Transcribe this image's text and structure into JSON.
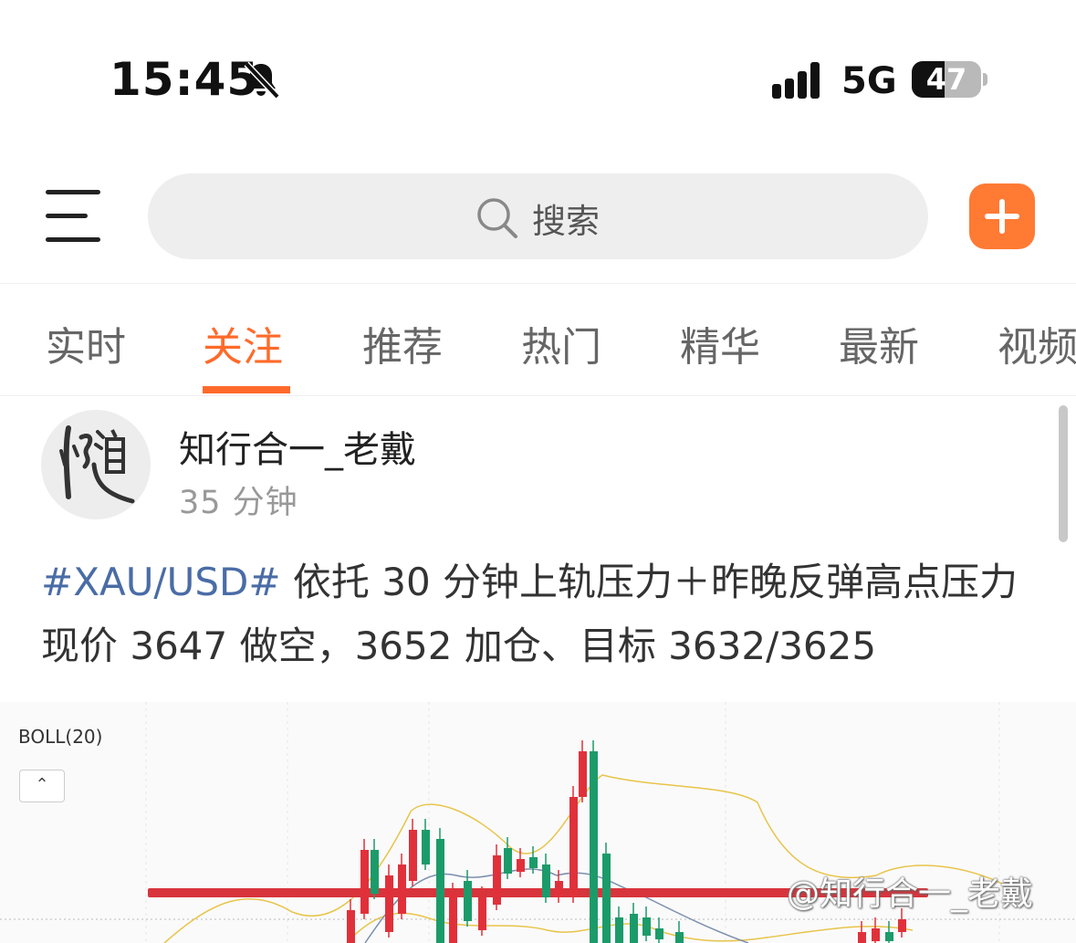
{
  "status_bar": {
    "time": "15:45",
    "network": "5G",
    "battery": "47",
    "battery_level": 0.47
  },
  "header": {
    "search_placeholder": "搜索"
  },
  "tabs": [
    {
      "label": "实时",
      "active": false
    },
    {
      "label": "关注",
      "active": true
    },
    {
      "label": "推荐",
      "active": false
    },
    {
      "label": "热门",
      "active": false
    },
    {
      "label": "精华",
      "active": false
    },
    {
      "label": "最新",
      "active": false
    },
    {
      "label": "视频",
      "active": false
    }
  ],
  "post": {
    "author": "知行合一_老戴",
    "time": "35 分钟",
    "hashtag": "#XAU/USD#",
    "text": " 依托 30 分钟上轨压力＋昨晚反弹高点压力现价 3647 做空，3652 加仓、目标 3632/3625",
    "chart": {
      "indicator_label": "BOLL(20)",
      "collapse_label": "⌃",
      "watermark": "@知行合一_老戴",
      "colors": {
        "up": "#e0313b",
        "down": "#1c9b6a",
        "boll": "#e8c44a",
        "mid": "#7b8fae",
        "resistance": "#d8343c"
      }
    }
  },
  "colors": {
    "accent": "#ff6a2a",
    "hashtag": "#4a6ca6"
  }
}
